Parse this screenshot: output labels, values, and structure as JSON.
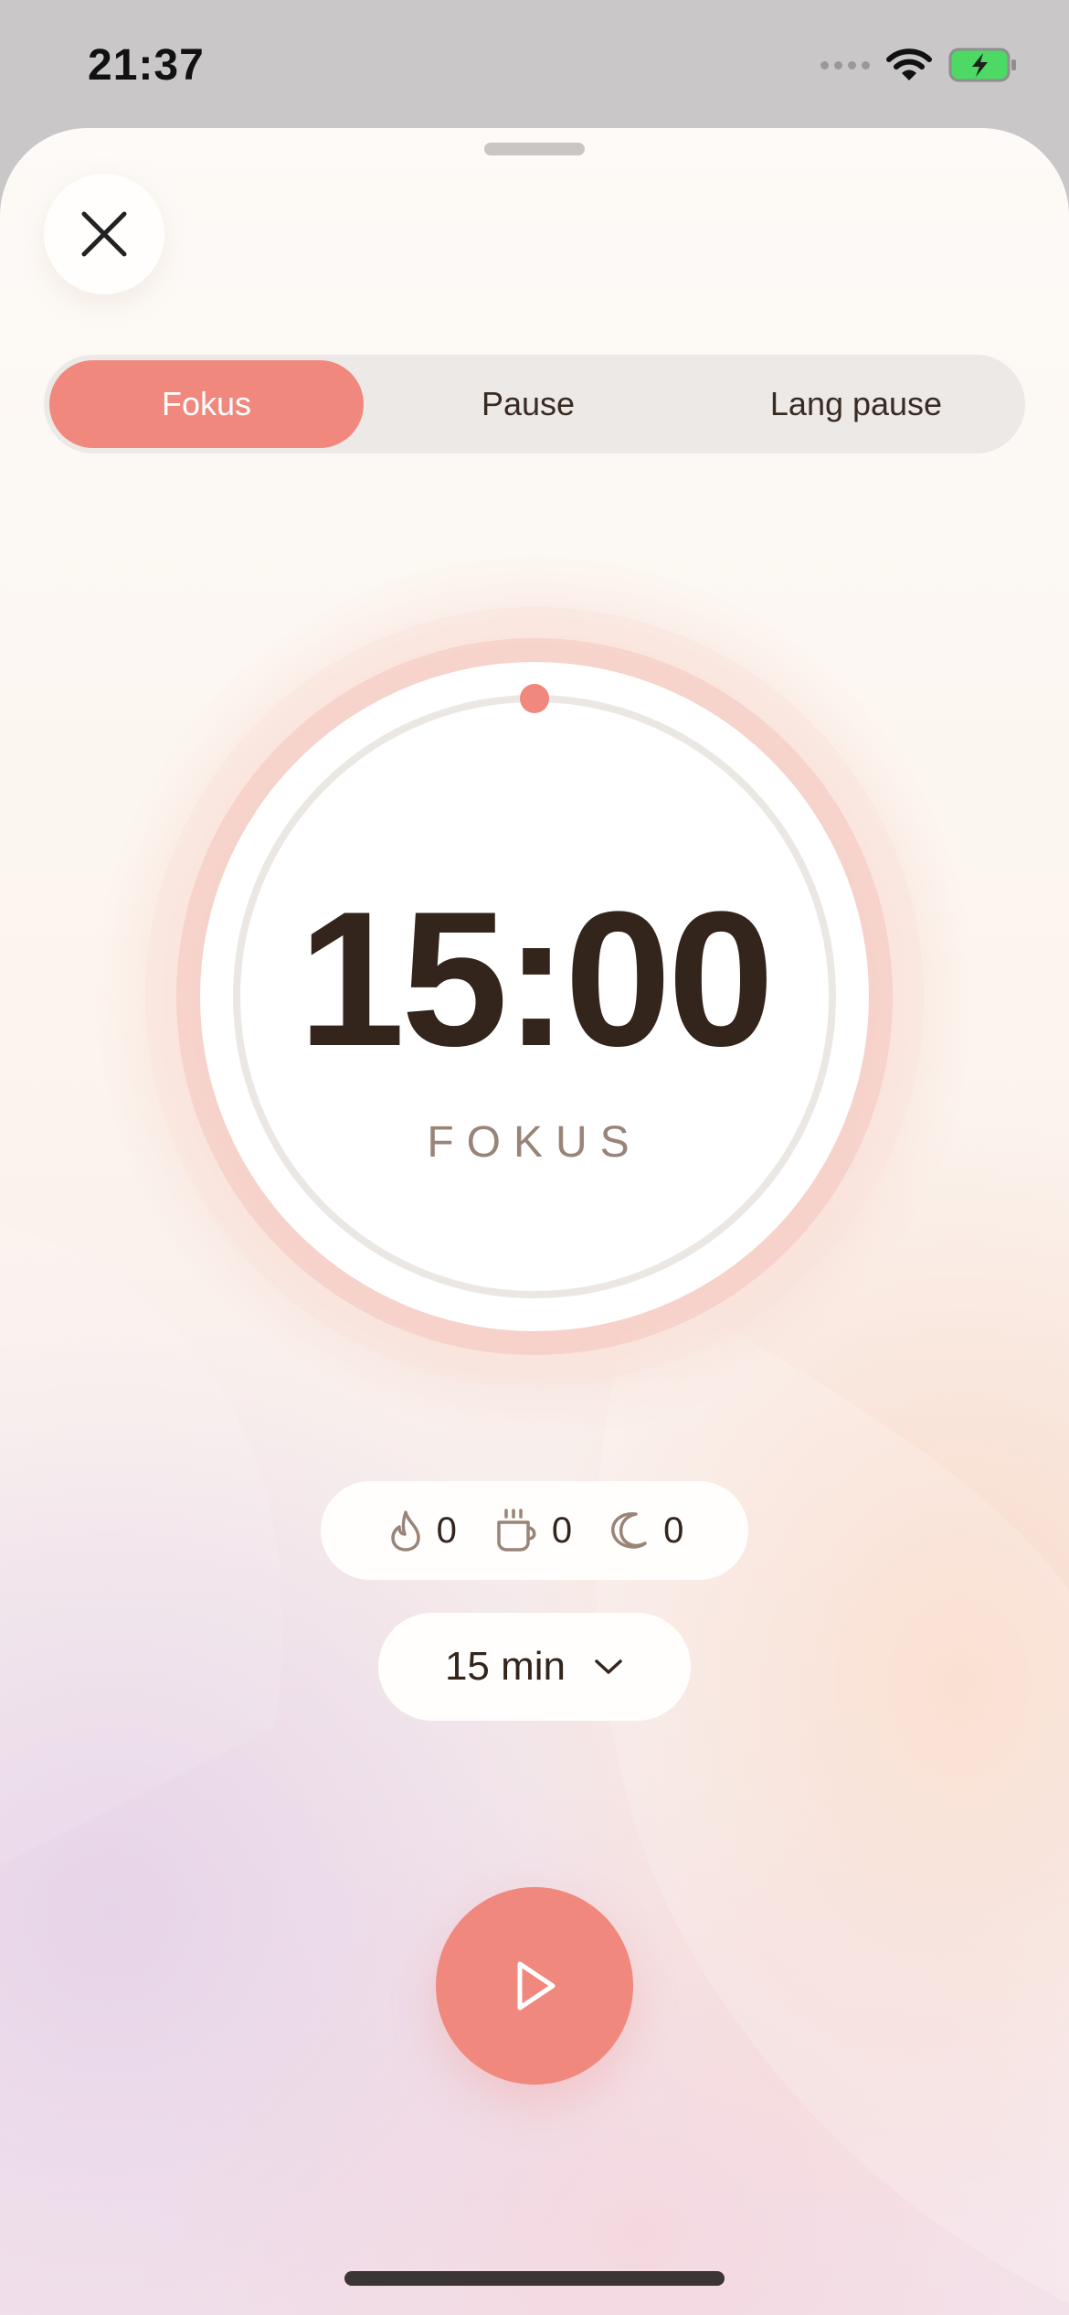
{
  "status_bar": {
    "time": "21:37"
  },
  "modes": [
    {
      "label": "Fokus",
      "active": true
    },
    {
      "label": "Pause",
      "active": false
    },
    {
      "label": "Lang pause",
      "active": false
    }
  ],
  "timer": {
    "time": "15:00",
    "label": "FOKUS",
    "progress": 0
  },
  "stats": [
    {
      "icon": "flame-icon",
      "value": "0"
    },
    {
      "icon": "coffee-cup-icon",
      "value": "0"
    },
    {
      "icon": "moon-icon",
      "value": "0"
    }
  ],
  "duration": {
    "value": "15 min"
  },
  "colors": {
    "accent": "#f0887e",
    "text": "#33241c",
    "muted": "#9a8478",
    "track": "#ebe8e4"
  }
}
